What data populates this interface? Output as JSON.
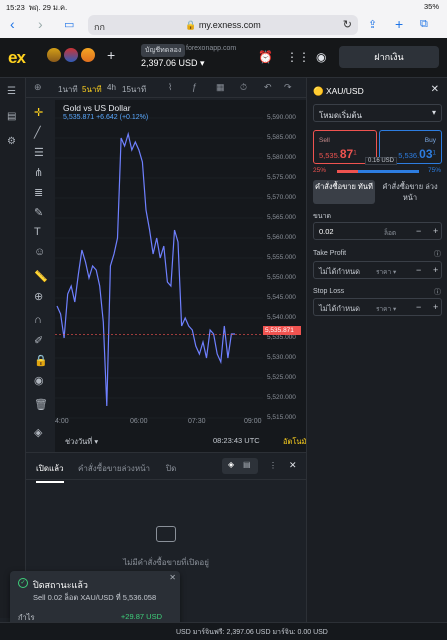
{
  "status": {
    "time": "15:23",
    "date": "พฤ. 29 ม.ค.",
    "battery": "35%"
  },
  "browser": {
    "aa": "กก",
    "url": "my.exness.com"
  },
  "header": {
    "logo": "ex",
    "account_badge": "บัญชีทดลอง",
    "server": "forexonapp.com",
    "balance": "2,397.06 USD",
    "deposit_label": "ฝากเงิน"
  },
  "chart_toolbar": {
    "timeframes": [
      "1นาที",
      "5นาที",
      "4h",
      "15นาที"
    ],
    "active_timeframe_index": 1
  },
  "chart": {
    "title": "Gold vs US Dollar",
    "quote": "5,535.871  +6.642 (+0.12%)",
    "price_tag": "5,535.871",
    "footer_range": "ช่วงวันที่",
    "footer_time": "08:23:43 UTC",
    "footer_auto": "อัตโนมัติ"
  },
  "chart_data": {
    "type": "line",
    "title": "Gold vs US Dollar",
    "x_ticks": [
      "4:00",
      "06:00",
      "07:30",
      "09:00"
    ],
    "y_ticks": [
      "5,590.000",
      "5,585.000",
      "5,580.000",
      "5,575.000",
      "5,570.000",
      "5,565.000",
      "5,560.000",
      "5,555.000",
      "5,550.000",
      "5,545.000",
      "5,540.000",
      "5,535.000",
      "5,530.000",
      "5,525.000",
      "5,520.000",
      "5,515.000"
    ],
    "ylim": [
      5515,
      5590
    ],
    "series": [
      {
        "color": "#7b7bff",
        "x": [
          0,
          1,
          2,
          3,
          4,
          5,
          6,
          7,
          8,
          9,
          10,
          11,
          12,
          13,
          14,
          15,
          16,
          17,
          18,
          19,
          20,
          21,
          22,
          23,
          24,
          25,
          26,
          27,
          28,
          29,
          30,
          31,
          32,
          33,
          34,
          35,
          36,
          37,
          38,
          39,
          40,
          41,
          42,
          43,
          44,
          45,
          46,
          47,
          48,
          49,
          50
        ],
        "values": [
          5543,
          5541,
          5535,
          5546,
          5548,
          5544,
          5551,
          5557,
          5554,
          5550,
          5553,
          5552,
          5548,
          5539,
          5518,
          5553,
          5556,
          5560,
          5585,
          5583,
          5586,
          5582,
          5584,
          5582,
          5579,
          5567,
          5562,
          5556,
          5560,
          5555,
          5558,
          5549,
          5548,
          5562,
          5559,
          5538,
          5540,
          5538,
          5537,
          5533,
          5531,
          5534,
          5530,
          5537,
          5536,
          5531,
          5529,
          5538,
          5530,
          5536,
          5536
        ]
      }
    ]
  },
  "bottom_tabs": {
    "open": "เปิดแล้ว",
    "pending": "คำสั่งซื้อขายล่วงหน้า",
    "closed": "ปิด"
  },
  "empty_state": "ไม่มีคำสั่งซื้อขายที่เปิดอยู่",
  "toast": {
    "title": "ปิดสถานะแล้ว",
    "message": "Sell 0.02 ล็อต XAU/USD ที่ 5,536.058",
    "pl_label": "กำไร",
    "pl_value": "+29.87 USD"
  },
  "bottom_bar": {
    "text": "USD   มาร์จินฟรี: 2,397.06 USD   มาร์จิน: 0.00 USD"
  },
  "order_panel": {
    "symbol": "XAU/USD",
    "mode": "โหมดเริ่มต้น",
    "sell_label": "Sell",
    "sell_price_prefix": "5,535.",
    "sell_price_big": "87",
    "sell_price_sup": "1",
    "buy_label": "Buy",
    "buy_price_prefix": "5,536.",
    "buy_price_big": "03",
    "buy_price_sup": "1",
    "spread": "0.16 USD",
    "sentiment_sell": "25%",
    "sentiment_buy": "75%",
    "sentiment_sell_fraction": 0.25,
    "tab_market": "คำสั่งซื้อขาย ทันที",
    "tab_pending": "คำสั่งซื้อขาย ล่วงหน้า",
    "volume_label": "ขนาด",
    "volume_value": "0.02",
    "volume_unit": "ล็อต",
    "tp_label": "Take Profit",
    "tp_value": "ไม่ได้กำหนด",
    "tp_unit": "ราคา",
    "sl_label": "Stop Loss",
    "sl_value": "ไม่ได้กำหนด",
    "sl_unit": "ราคา"
  }
}
